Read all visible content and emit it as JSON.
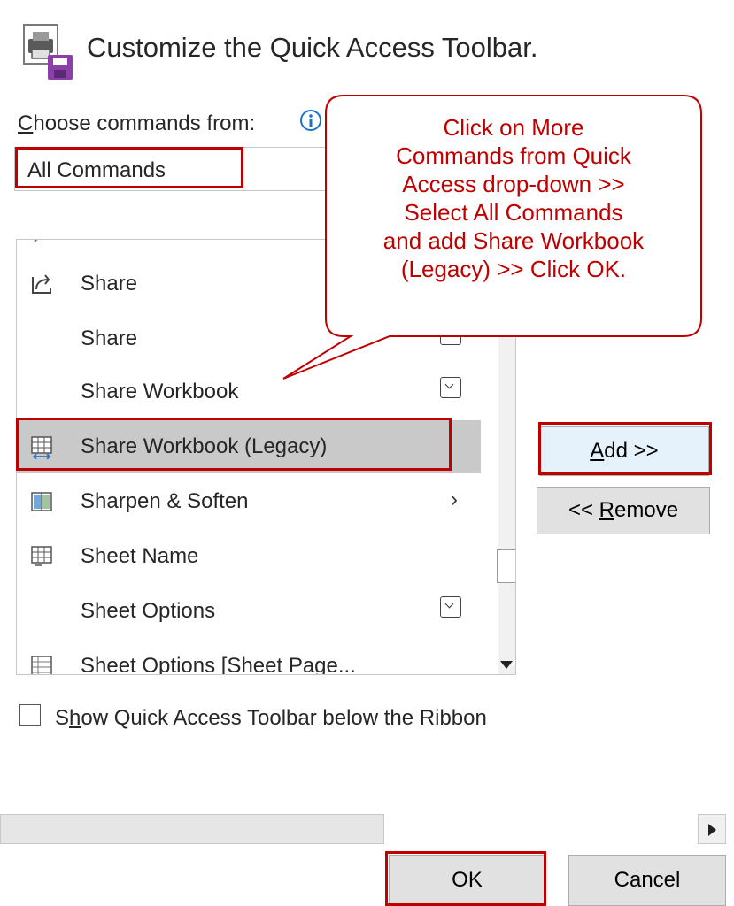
{
  "header": {
    "title": "Customize the Quick Access Toolbar."
  },
  "choose": {
    "label_accesskey": "C",
    "label_rest": "hoose commands from:",
    "selected": "All Commands"
  },
  "commands": [
    {
      "label": "Share",
      "icon": "share-icon",
      "extra": ""
    },
    {
      "label": "Share",
      "icon": "",
      "extra": "split-dropdown"
    },
    {
      "label": "Share Workbook",
      "icon": "",
      "extra": "split-dropdown"
    },
    {
      "label": "Share Workbook (Legacy)",
      "icon": "share-workbook-legacy-icon",
      "extra": "",
      "selected": true
    },
    {
      "label": "Sharpen & Soften",
      "icon": "sharpen-soften-icon",
      "extra": "submenu"
    },
    {
      "label": "Sheet Name",
      "icon": "sheet-name-icon",
      "extra": ""
    },
    {
      "label": "Sheet Options",
      "icon": "",
      "extra": "split-dropdown"
    },
    {
      "label": "Sheet Options [Sheet Page...",
      "icon": "sheet-options-icon",
      "extra": ""
    }
  ],
  "buttons": {
    "add_accesskey": "A",
    "add_rest": "dd >>",
    "remove_prefix": "<< ",
    "remove_accesskey": "R",
    "remove_rest": "emove",
    "ok": "OK",
    "cancel": "Cancel"
  },
  "checkbox": {
    "prefix": "S",
    "accesskey": "h",
    "rest": "ow Quick Access Toolbar below the Ribbon",
    "checked": false
  },
  "callout": {
    "lines": [
      "Click on More",
      "Commands from Quick",
      "Access drop-down >>",
      "Select All Commands",
      "and add Share Workbook",
      "(Legacy) >> Click OK."
    ]
  },
  "colors": {
    "annotation_red": "#c00000",
    "selection_gray": "#c9c9c9",
    "add_button_bg": "#e5f1fb"
  }
}
